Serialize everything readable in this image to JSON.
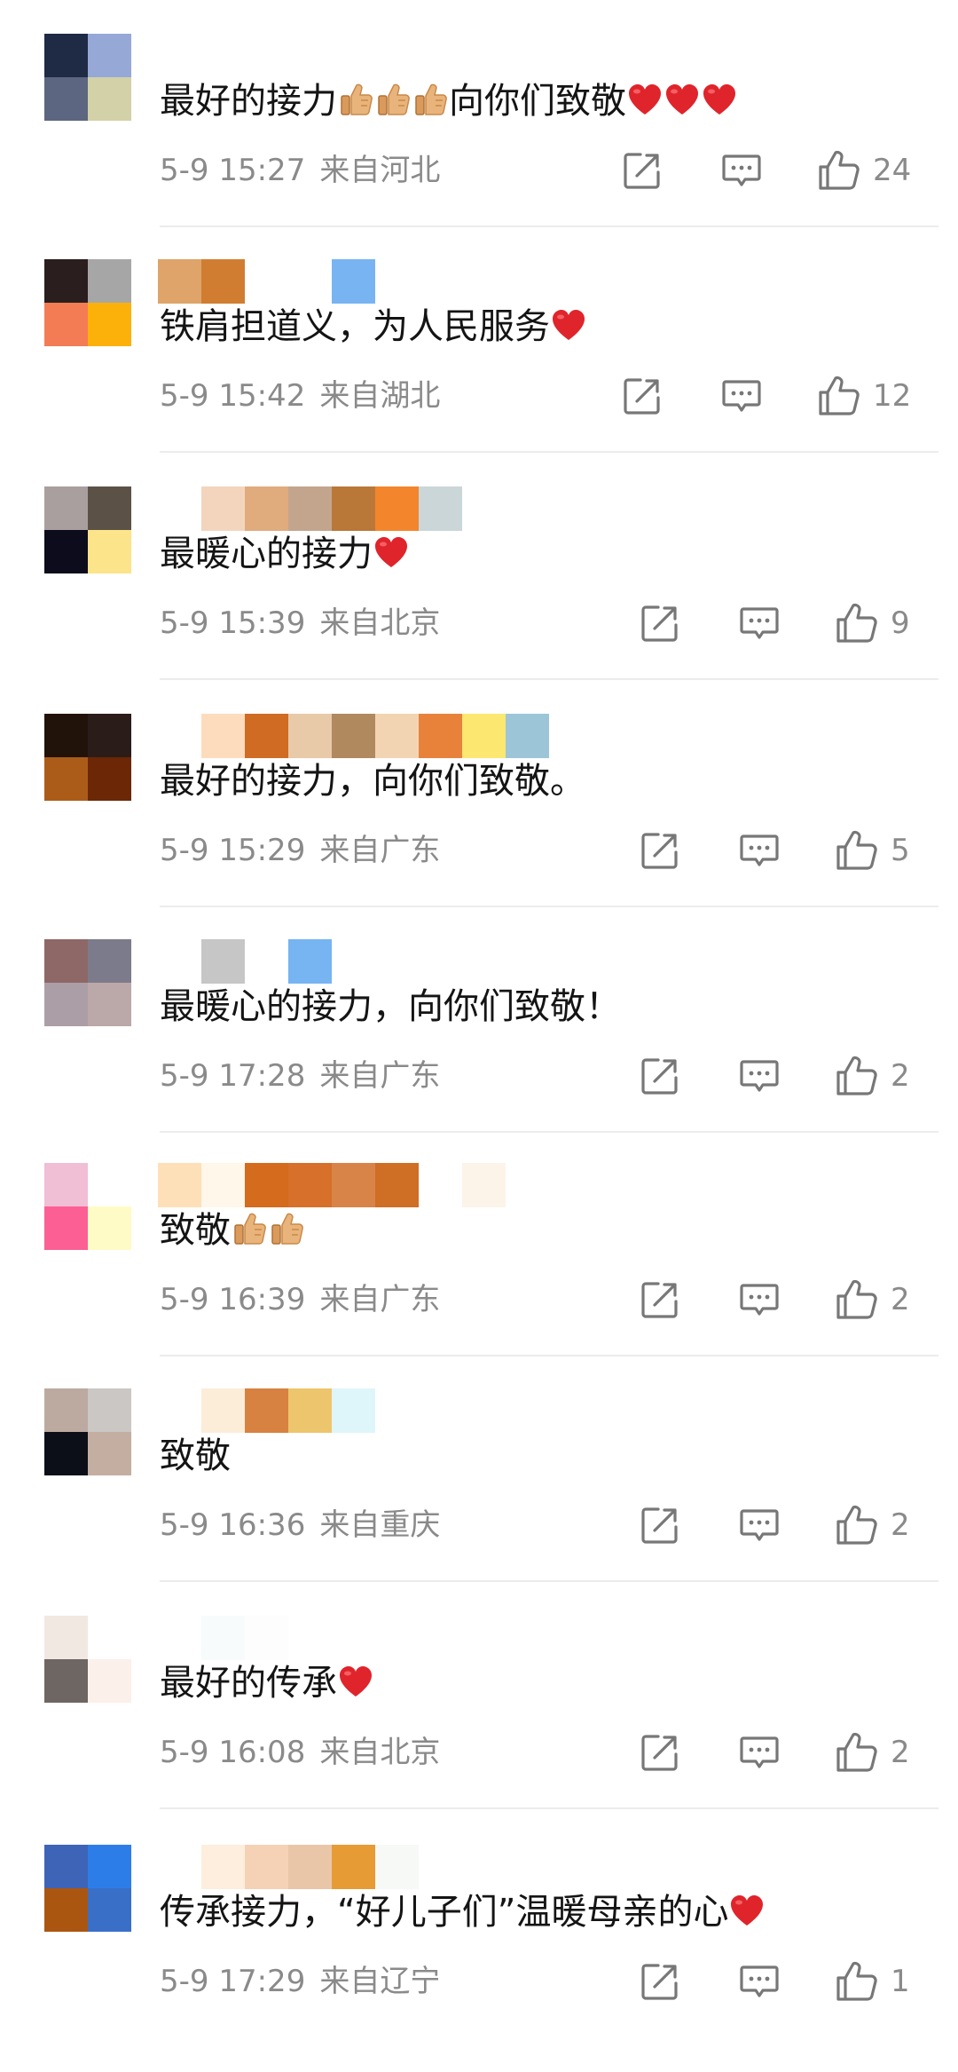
{
  "colors": {
    "text": "#141414",
    "meta": "#8a8a8a",
    "icon": "#777777",
    "heart": "#e0242b",
    "thumb": "#e9b47b",
    "divider": "#ececec"
  },
  "comments": [
    {
      "text_before": "最好的接力",
      "emojis_mid": [
        "thumbs-up-emoji",
        "thumbs-up-emoji",
        "thumbs-up-emoji"
      ],
      "text_after": "向你们致敬",
      "emojis_end": [
        "heart-emoji",
        "heart-emoji",
        "heart-emoji"
      ],
      "time": "5-9 15:27",
      "location": "来自河北",
      "likes": "24",
      "avatar_colors": [
        "#1f2a44",
        "#95a8d6",
        "#5c6680",
        "#d2d1a8"
      ],
      "name_colors": []
    },
    {
      "text_before": "铁肩担道义，为人民服务",
      "emojis_end": [
        "heart-emoji"
      ],
      "time": "5-9 15:42",
      "location": "来自湖北",
      "likes": "12",
      "avatar_colors": [
        "#2a1e1e",
        "#a7a6a7",
        "#f47c54",
        "#fbb10a"
      ],
      "name_colors": [
        "#dea46a",
        "#d07d31",
        "#ffffff",
        "#ffffff",
        "#78b4f2"
      ]
    },
    {
      "text_before": "最暖心的接力",
      "emojis_end": [
        "heart-emoji"
      ],
      "time": "5-9 15:39",
      "location": "来自北京",
      "likes": "9",
      "avatar_colors": [
        "#a89f9e",
        "#5b5147",
        "#0c0c1c",
        "#fbe48a"
      ],
      "name_colors": [
        "#ffffff",
        "#f3d5bd",
        "#e0ab7d",
        "#c3a58d",
        "#b97838",
        "#f3852d",
        "#cad6d8"
      ]
    },
    {
      "text_before": "最好的接力，向你们致敬。",
      "time": "5-9 15:29",
      "location": "来自广东",
      "likes": "5",
      "avatar_colors": [
        "#211309",
        "#2a1d19",
        "#ac5c19",
        "#6c2706"
      ],
      "name_colors": [
        "#ffffff",
        "#fddcbd",
        "#d06b23",
        "#e8c9a8",
        "#b0895e",
        "#f2d4b3",
        "#e8823b",
        "#fce770",
        "#9cc5d8"
      ]
    },
    {
      "text_before": "最暖心的接力，向你们致敬！",
      "time": "5-9 17:28",
      "location": "来自广东",
      "likes": "2",
      "avatar_colors": [
        "#8e6866",
        "#7c7b8b",
        "#ac9ea6",
        "#bba8a8"
      ],
      "name_colors": [
        "#ffffff",
        "#c6c6c6",
        "#ffffff",
        "#76b4f2"
      ]
    },
    {
      "text_before": "致敬",
      "emojis_end": [
        "thumbs-up-emoji",
        "thumbs-up-emoji"
      ],
      "time": "5-9 16:39",
      "location": "来自广东",
      "likes": "2",
      "avatar_colors": [
        "#f0bed5",
        "#ffffff",
        "#fb5f94",
        "#fefbc6"
      ],
      "name_colors": [
        "#fee0b8",
        "#fef7ea",
        "#d46b1d",
        "#d6702a",
        "#d88449",
        "#cf6e25",
        "#ffffff",
        "#fcf4e8"
      ]
    },
    {
      "text_before": "致敬",
      "time": "5-9 16:36",
      "location": "来自重庆",
      "likes": "2",
      "avatar_colors": [
        "#bcaaa1",
        "#cbc7c4",
        "#0c0f18",
        "#c4ada1"
      ],
      "name_colors": [
        "#ffffff",
        "#fcedd9",
        "#d88241",
        "#edc56c",
        "#def6f9"
      ]
    },
    {
      "text_before": "最好的传承",
      "emojis_end": [
        "heart-emoji"
      ],
      "time": "5-9 16:08",
      "location": "来自北京",
      "likes": "2",
      "avatar_colors": [
        "#f1e8e2",
        "#ffffff",
        "#6e6663",
        "#fcf0ea"
      ],
      "name_colors": [
        "#ffffff",
        "#f8fbfb",
        "#fdfdfd"
      ]
    },
    {
      "text_before": "传承接力，“好儿子们”温暖母亲的心",
      "emojis_end": [
        "heart-emoji"
      ],
      "time": "5-9 17:29",
      "location": "来自辽宁",
      "likes": "1",
      "avatar_colors": [
        "#3d64b6",
        "#2d7de9",
        "#aa5611",
        "#3a6fc8"
      ],
      "name_colors": [
        "#ffffff",
        "#fdeedd",
        "#f5d2b6",
        "#e9c6a8",
        "#e69b35",
        "#f6f9f5"
      ]
    }
  ]
}
